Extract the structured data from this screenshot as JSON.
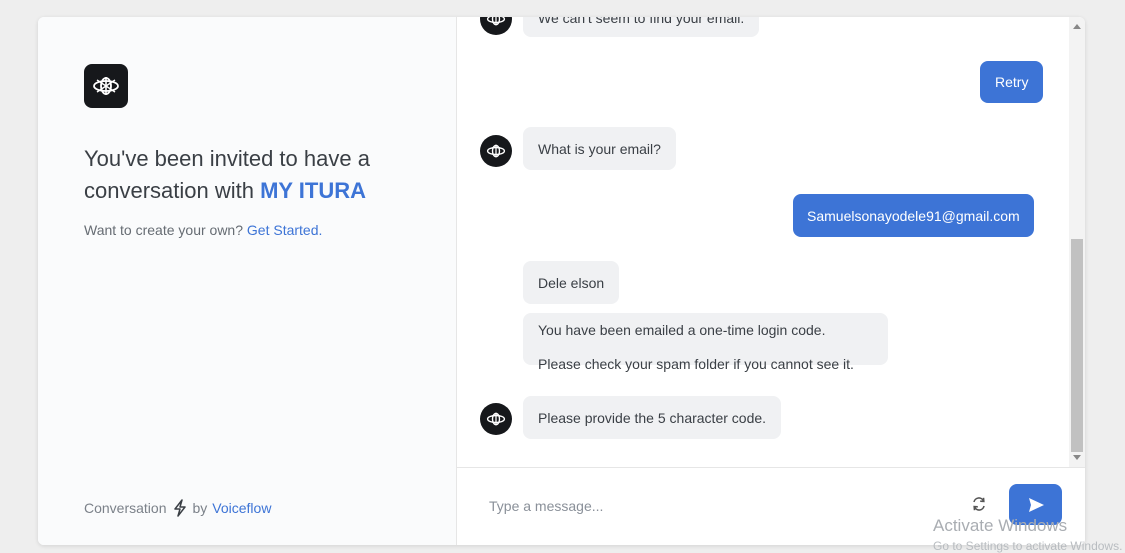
{
  "invite": {
    "line1": "You've been invited to have a",
    "line2_prefix": "conversation with ",
    "brand": "MY ITURA"
  },
  "subtitle": {
    "text": "Want to create your own? ",
    "link": "Get Started."
  },
  "footer": {
    "prefix": "Conversation",
    "by": "by",
    "link": "Voiceflow",
    "icon": "lightning-bolt-icon"
  },
  "messages": {
    "truncated_top": "We can't seem to find your email.",
    "retry_button": "Retry",
    "ask_email": "What is your email?",
    "user_email": "Samuelsonayodele91@gmail.com",
    "name_reply": "Dele elson",
    "emailed_line1": "You have been emailed a one-time login code.",
    "emailed_line2": "Please check your spam folder if you cannot see it.",
    "ask_code": "Please provide the 5 character code."
  },
  "input": {
    "placeholder": "Type a message..."
  },
  "watermark": {
    "title": "Activate Windows",
    "subtitle": "Go to Settings to activate Windows."
  },
  "colors": {
    "accent": "#3d74d6",
    "bot_bubble": "#f0f1f3",
    "avatar": "#16181b"
  }
}
